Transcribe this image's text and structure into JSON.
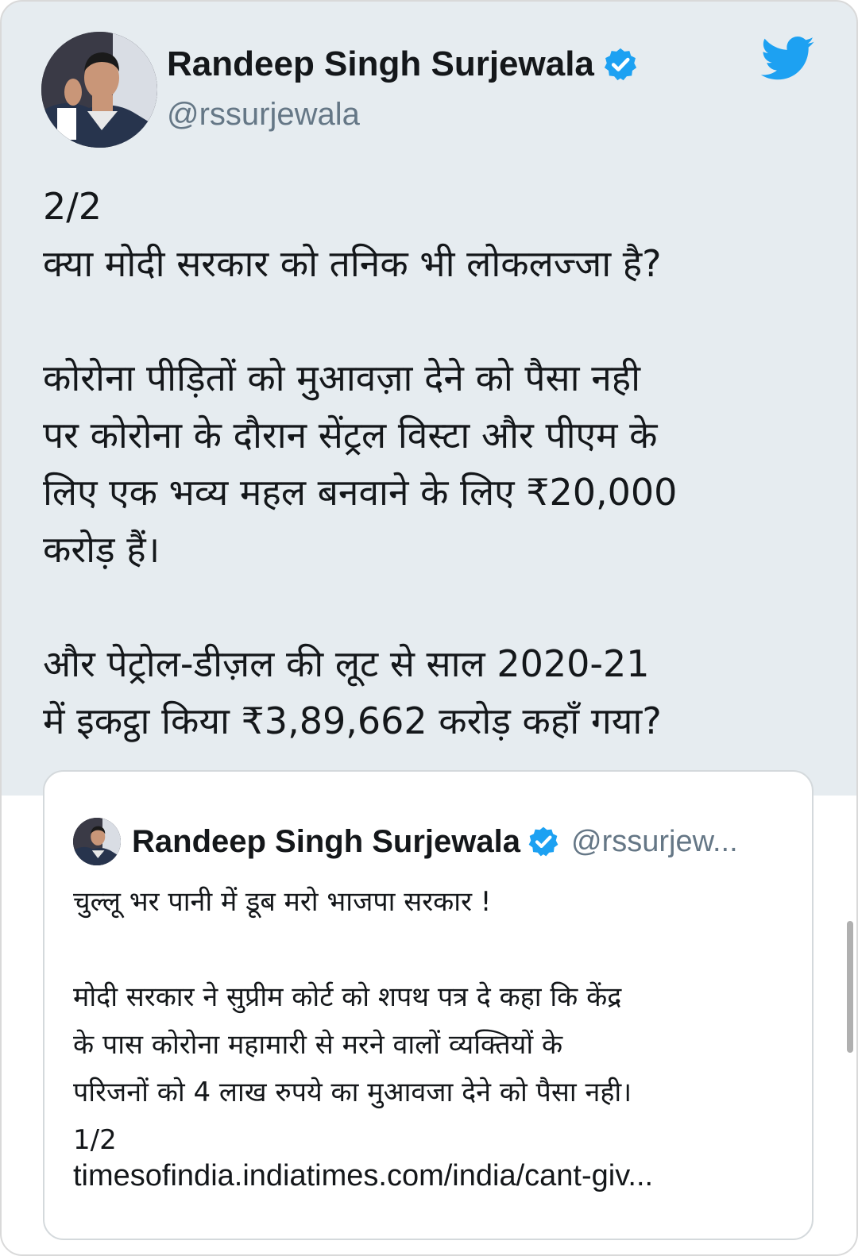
{
  "tweet": {
    "author_name": "Randeep Singh Surjewala",
    "author_handle": "@rssurjewala",
    "text": "2/2\nक्या मोदी सरकार को तनिक भी लोकलज्जा है?\n\nकोरोना पीड़ितों को मुआवज़ा देने को पैसा नही\nपर कोरोना के दौरान सेंट्रल विस्टा और पीएम के\nलिए एक भव्य महल बनवाने के लिए ₹20,000\nकरोड़ हैं।\n\nऔर पेट्रोल-डीज़ल की लूट से साल 2020-21\nमें इकट्ठा किया ₹3,89,662 करोड़ कहाँ गया?"
  },
  "quoted_tweet": {
    "author_name": "Randeep Singh Surjewala",
    "author_handle": "@rssurjew...",
    "text": "चुल्लू भर पानी में डूब मरो भाजपा सरकार !\n\nमोदी सरकार ने सुप्रीम कोर्ट को शपथ पत्र दे कहा कि केंद्र\nके पास कोरोना महामारी से मरने वालों व्यक्तियों के\nपरिजनों को 4 लाख रुपये का मुआवजा देने को पैसा नही।\n1/2",
    "link": "timesofindia.indiatimes.com/india/cant-giv..."
  },
  "icons": {
    "verified": "verified-badge-icon",
    "brand": "twitter-bird-icon"
  },
  "colors": {
    "background": "#e6ecf0",
    "twitter_blue": "#1da1f2",
    "text": "#14171a",
    "secondary_text": "#657786"
  }
}
